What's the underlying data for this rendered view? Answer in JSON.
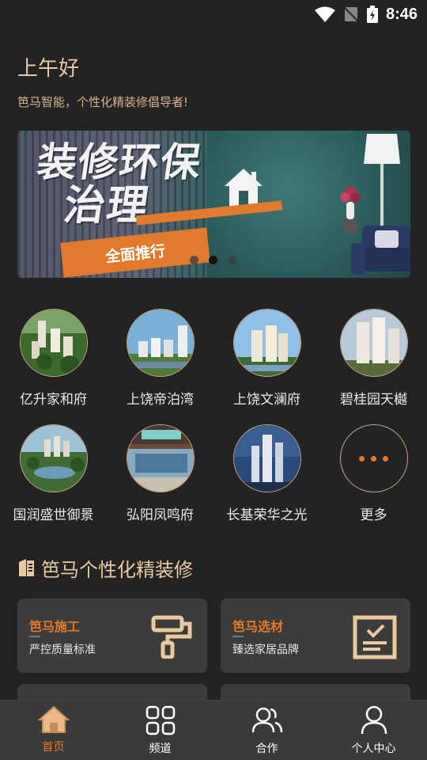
{
  "status_bar": {
    "time": "8:46"
  },
  "header": {
    "greeting": "上午好",
    "slogan": "笆马智能，个性化精装修倡导者!"
  },
  "banner": {
    "line1": "装修环保",
    "line2": "治理",
    "tag": "全面推行",
    "active_dot": 1,
    "dot_count": 3
  },
  "projects": [
    {
      "name": "亿升家和府"
    },
    {
      "name": "上饶帝泊湾"
    },
    {
      "name": "上饶文澜府"
    },
    {
      "name": "碧桂园天樾"
    },
    {
      "name": "国润盛世御景"
    },
    {
      "name": "弘阳凤鸣府"
    },
    {
      "name": "长基荣华之光"
    },
    {
      "name": "更多"
    }
  ],
  "section": {
    "title": "笆马个性化精装修"
  },
  "cards": [
    {
      "title": "笆马施工",
      "subtitle": "严控质量标准",
      "icon": "paint-roller-icon"
    },
    {
      "title": "笆马选材",
      "subtitle": "臻选家居品牌",
      "icon": "checklist-icon"
    }
  ],
  "bottom_nav": [
    {
      "label": "首页",
      "icon": "home-icon",
      "active": true
    },
    {
      "label": "频道",
      "icon": "grid-icon",
      "active": false
    },
    {
      "label": "合作",
      "icon": "people-icon",
      "active": false
    },
    {
      "label": "个人中心",
      "icon": "person-icon",
      "active": false
    }
  ],
  "colors": {
    "background": "#232323",
    "accent": "#e07a2c",
    "gold": "#e9c9a0",
    "card": "#3c3c3c",
    "nav": "#3a3a3a"
  }
}
